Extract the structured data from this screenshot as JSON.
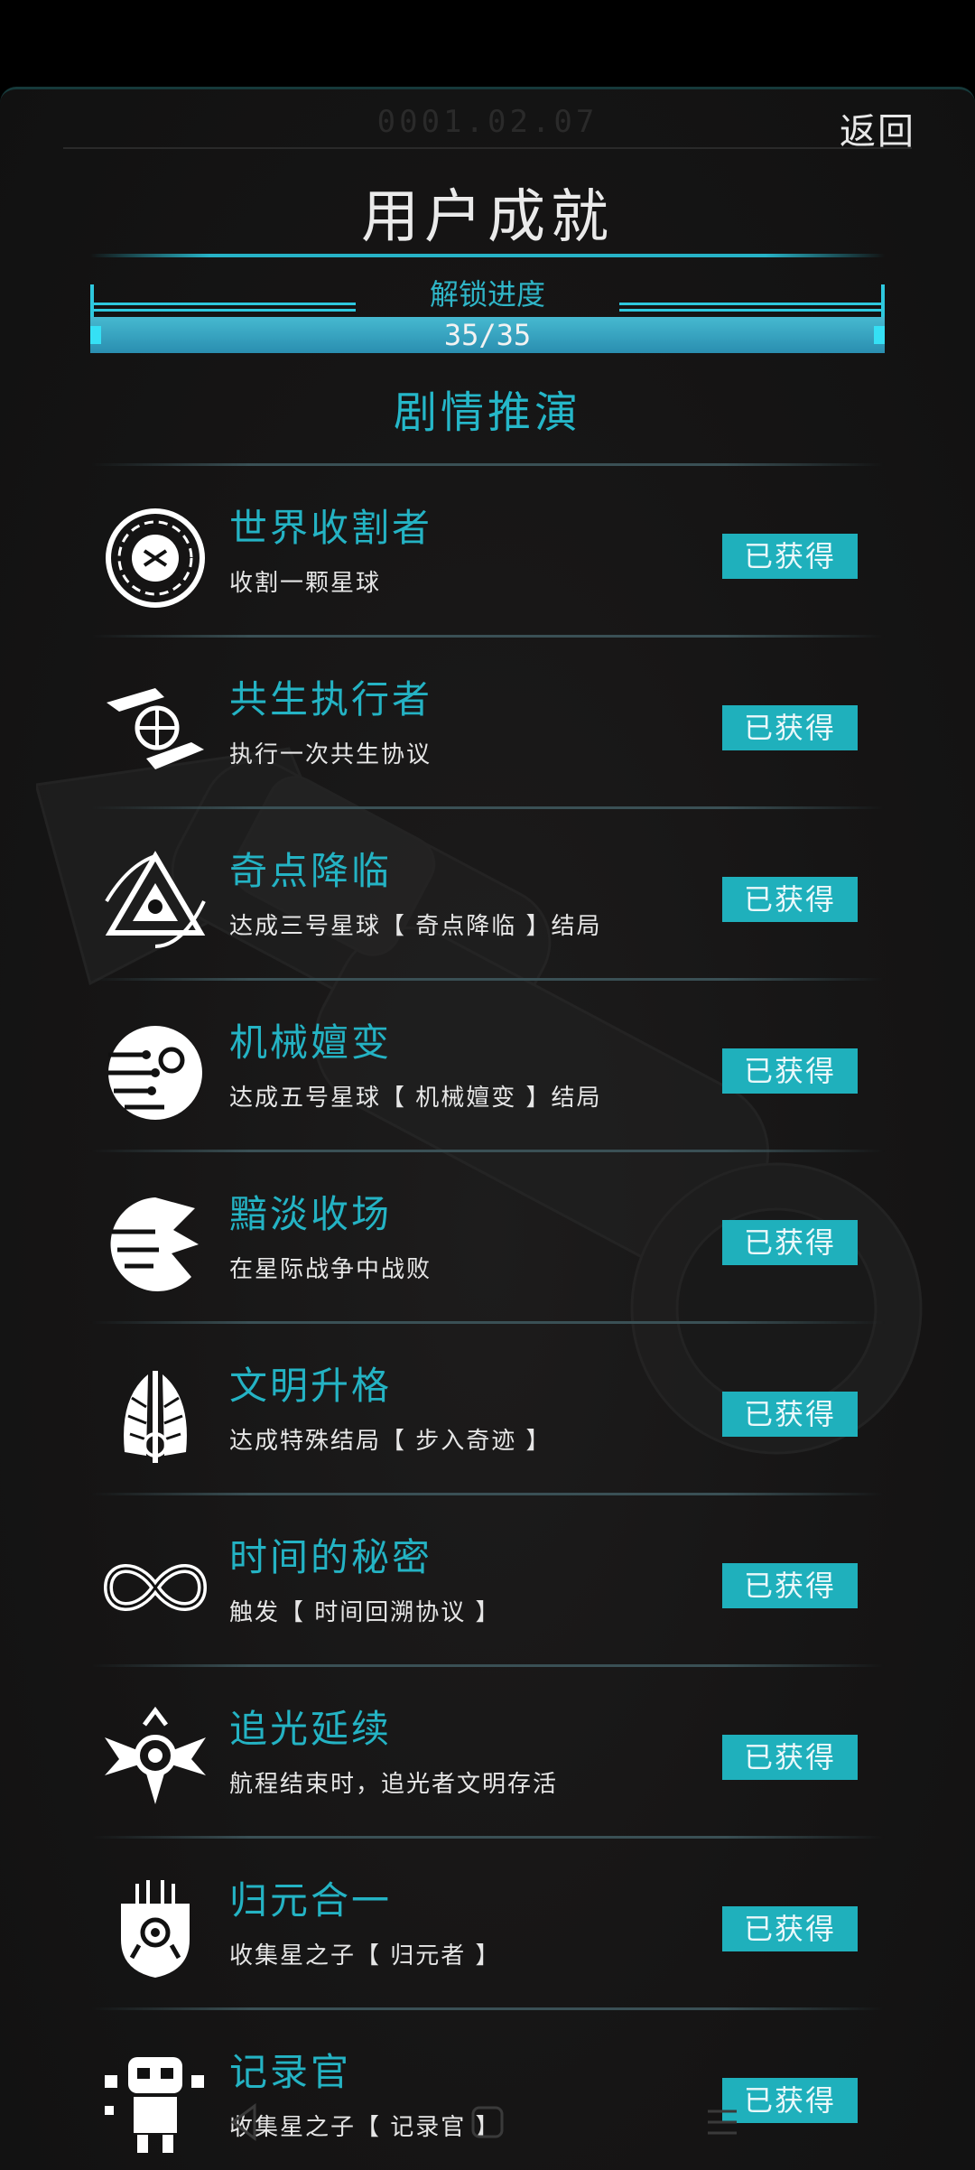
{
  "header": {
    "date": "0001.02.07",
    "back_label": "返回",
    "title": "用户成就"
  },
  "progress": {
    "label": "解锁进度",
    "text": "35/35",
    "unlocked": 35,
    "total": 35,
    "fraction": 1.0
  },
  "section": {
    "title": "剧情推演"
  },
  "achievements": [
    {
      "name": "世界收割者",
      "desc": "收割一颗星球",
      "status": "已获得",
      "icon": "planet-harvest-icon"
    },
    {
      "name": "共生执行者",
      "desc": "执行一次共生协议",
      "status": "已获得",
      "icon": "symbiosis-hands-globe-icon"
    },
    {
      "name": "奇点降临",
      "desc": "达成三号星球【 奇点降临 】结局",
      "status": "已获得",
      "icon": "singularity-triangle-icon"
    },
    {
      "name": "机械嬗变",
      "desc": "达成五号星球【 机械嬗变 】结局",
      "status": "已获得",
      "icon": "mechanical-planet-icon"
    },
    {
      "name": "黯淡收场",
      "desc": "在星际战争中战败",
      "status": "已获得",
      "icon": "shattered-planet-icon"
    },
    {
      "name": "文明升格",
      "desc": "达成特殊结局【 步入奇迹 】",
      "status": "已获得",
      "icon": "winged-emblem-icon"
    },
    {
      "name": "时间的秘密",
      "desc": "触发【 时间回溯协议 】",
      "status": "已获得",
      "icon": "infinity-icon"
    },
    {
      "name": "追光延续",
      "desc": "航程结束时，追光者文明存活",
      "status": "已获得",
      "icon": "winged-sun-icon"
    },
    {
      "name": "归元合一",
      "desc": "收集星之子【 归元者 】",
      "status": "已获得",
      "icon": "mask-circuit-icon"
    },
    {
      "name": "记录官",
      "desc": "收集星之子【 记录官 】",
      "status": "已获得",
      "icon": "recorder-robot-icon"
    }
  ],
  "colors": {
    "accent": "#24b3c4",
    "badge": "#1fb0bc",
    "background": "#161515"
  }
}
